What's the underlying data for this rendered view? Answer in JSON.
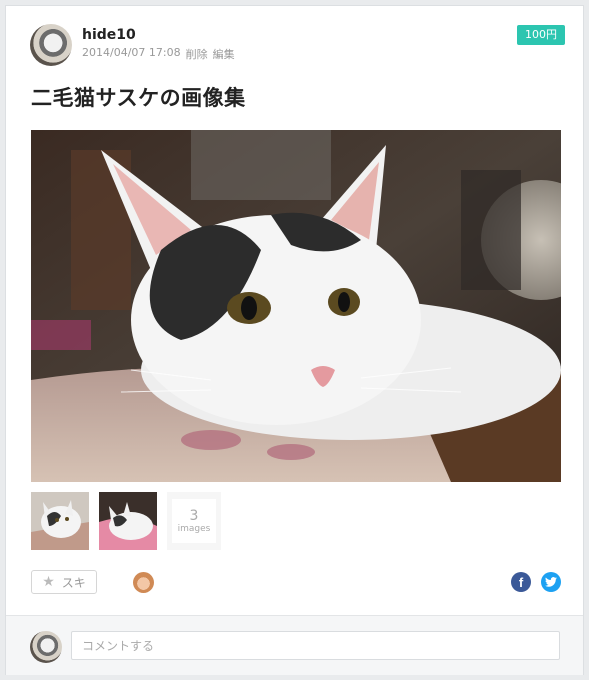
{
  "post": {
    "author": "hide10",
    "date": "2014/04/07 17:08",
    "delete_label": "削除",
    "edit_label": "編集",
    "price_label": "100円",
    "title": "二毛猫サスケの画像集"
  },
  "gallery": {
    "more_count": "3",
    "more_label": "images"
  },
  "actions": {
    "like_label": "スキ",
    "like_icon": "star-icon",
    "facebook_icon": "f",
    "twitter_icon": "twitter-bird-icon"
  },
  "comment": {
    "placeholder": "コメントする"
  },
  "colors": {
    "price_badge": "#2cc5b0",
    "facebook": "#3b5998",
    "twitter": "#1da1f2"
  }
}
